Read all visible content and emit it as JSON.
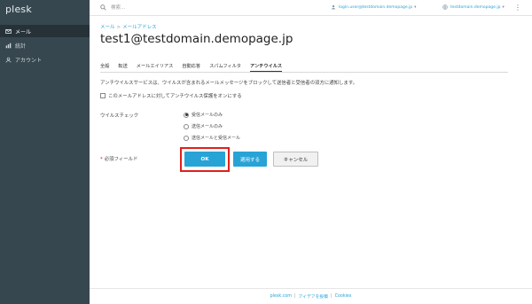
{
  "app": {
    "logo": "plesk"
  },
  "sidebar": {
    "items": [
      {
        "label": "メール",
        "icon": "mail-icon",
        "active": true
      },
      {
        "label": "統計",
        "icon": "chart-icon",
        "active": false
      },
      {
        "label": "アカウント",
        "icon": "account-icon",
        "active": false
      }
    ],
    "collapse_glyph": "«"
  },
  "topbar": {
    "search_placeholder": "検索...",
    "user": "login.user@testdomain.demopage.jp",
    "domain": "testdomain.demopage.jp",
    "kebab": "⋮"
  },
  "breadcrumb": [
    "メール",
    "メールアドレス"
  ],
  "page": {
    "title": "test1@testdomain.demopage.jp"
  },
  "tabs": [
    {
      "label": "全般",
      "active": false
    },
    {
      "label": "転送",
      "active": false
    },
    {
      "label": "メールエイリアス",
      "active": false
    },
    {
      "label": "自動応答",
      "active": false
    },
    {
      "label": "スパムフィルタ",
      "active": false
    },
    {
      "label": "アンチウイルス",
      "active": true
    }
  ],
  "antivirus": {
    "description": "アンチウイルスサービスは、ウイルスが含まれるメールメッセージをブロックして送信者と受信者の双方に通知します。",
    "enable_checkbox_label": "このメールアドレスに対してアンチウイルス保護をオンにする",
    "enable_checked": false,
    "virus_check_label": "ウイルスチェック",
    "options": [
      {
        "label": "受信メールのみ",
        "selected": true
      },
      {
        "label": "送信メールのみ",
        "selected": false
      },
      {
        "label": "送信メールと受信メール",
        "selected": false
      }
    ]
  },
  "form": {
    "required_mark": "*",
    "required_label": "必須フィールド",
    "ok_label": "OK",
    "apply_label": "適用する",
    "cancel_label": "キャンセル"
  },
  "footer": {
    "links": [
      "plesk.com",
      "アイデアを投稿",
      "Cookies"
    ]
  },
  "colors": {
    "sidebar": "#37474f",
    "accent": "#28a3d6",
    "highlight": "#e0201b"
  }
}
